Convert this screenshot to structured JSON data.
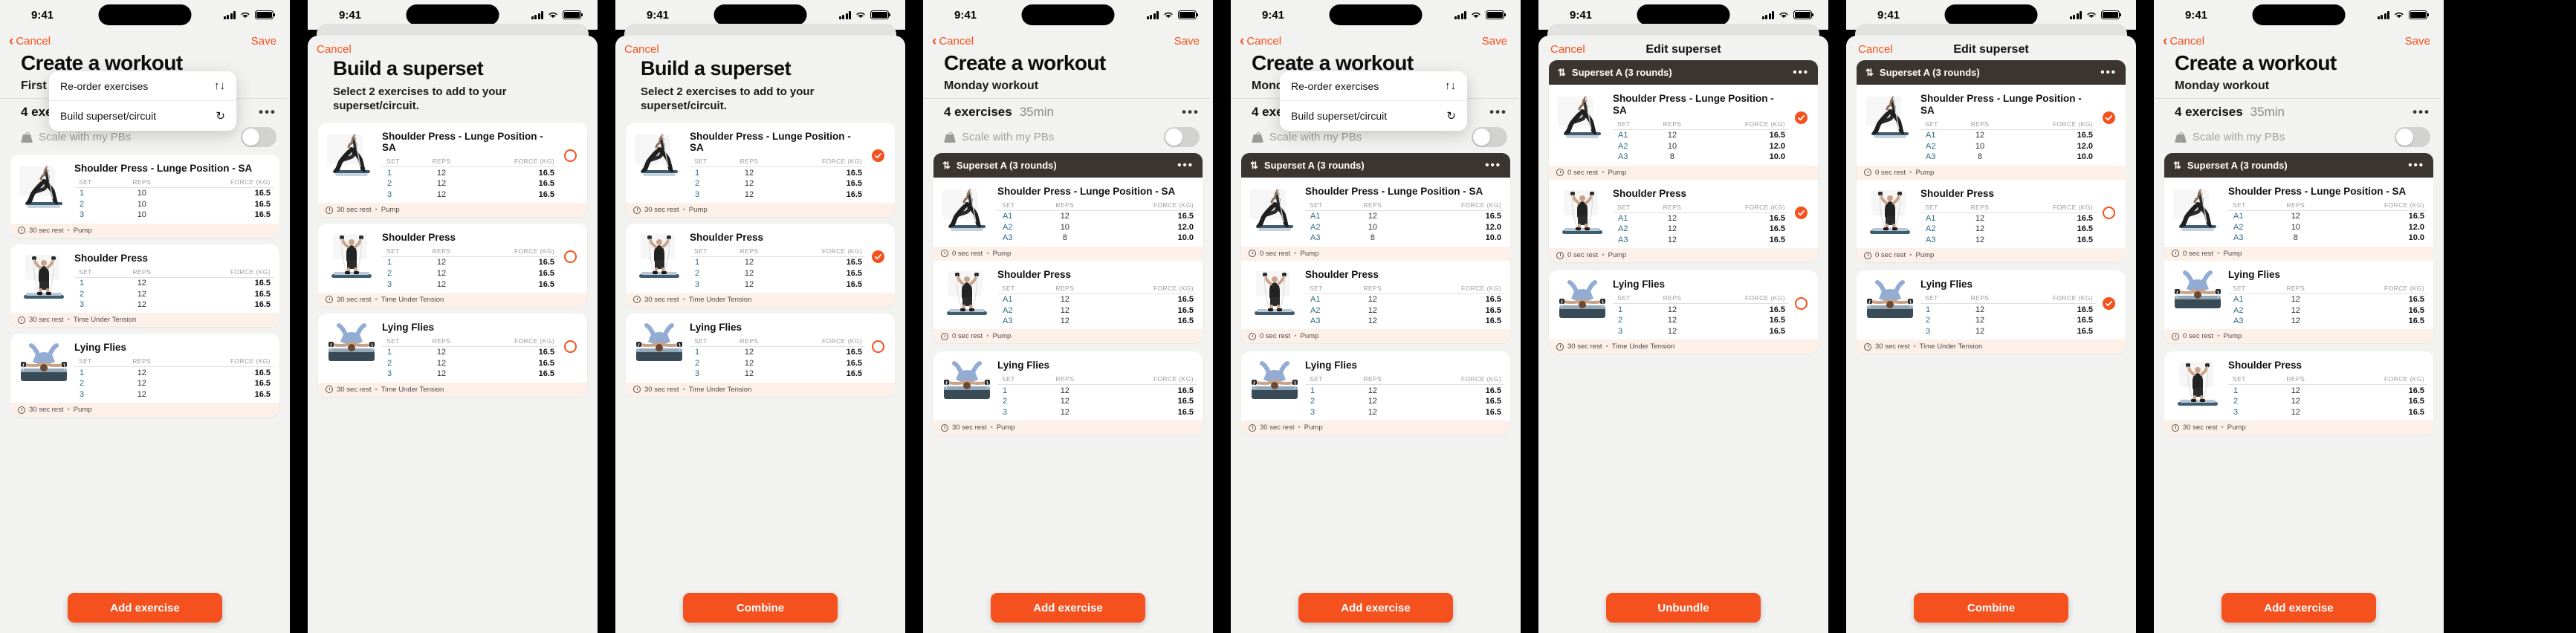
{
  "status_bar": {
    "time": "9:41"
  },
  "colors": {
    "accent": "#f4511e",
    "superset_header": "#3a3530",
    "card_foot": "#fdf0e9"
  },
  "common": {
    "cancel": "Cancel",
    "save": "Save",
    "dots": "•••",
    "swap_icon": "⇅",
    "reorder_icon": "↑↓",
    "loop_icon": "↻"
  },
  "menu": {
    "items": [
      {
        "label": "Re-order exercises",
        "icon": "arrows-up-down-icon",
        "glyph": "↑↓"
      },
      {
        "label": "Build superset/circuit",
        "icon": "loop-refresh-icon",
        "glyph": "↻"
      }
    ]
  },
  "screens": [
    {
      "id": "create-workout-menu-open",
      "type": "create",
      "title": "Create a workout",
      "subtitle": "First workout",
      "exercise_count": "4 exercises",
      "duration": "",
      "scale_label": "Scale with my PBs",
      "menu_open": true,
      "cta": "Add exercise",
      "cards": [
        {
          "name": "Shoulder Press - Lunge Position - SA",
          "thumb": "woman-lunge-press",
          "headers": [
            "SET",
            "REPS",
            "FORCE (KG)"
          ],
          "rows": [
            [
              "1",
              "10",
              "16.5"
            ],
            [
              "2",
              "10",
              "16.5"
            ],
            [
              "3",
              "10",
              "16.5"
            ]
          ],
          "rest": "30 sec rest",
          "mode": "Pump",
          "select": "none"
        },
        {
          "name": "Shoulder Press",
          "thumb": "man-shoulder-press",
          "headers": [
            "SET",
            "REPS",
            "FORCE (KG)"
          ],
          "rows": [
            [
              "1",
              "12",
              "16.5"
            ],
            [
              "2",
              "12",
              "16.5"
            ],
            [
              "3",
              "12",
              "16.5"
            ]
          ],
          "rest": "30 sec rest",
          "mode": "Time Under Tension",
          "select": "none"
        },
        {
          "name": "Lying Flies",
          "thumb": "lying-flies",
          "headers": [
            "SET",
            "REPS",
            "FORCE (KG)"
          ],
          "rows": [
            [
              "1",
              "12",
              "16.5"
            ],
            [
              "2",
              "12",
              "16.5"
            ],
            [
              "3",
              "12",
              "16.5"
            ]
          ],
          "rest": "30 sec rest",
          "mode": "Pump",
          "select": "none"
        }
      ]
    },
    {
      "id": "build-superset-unselected",
      "type": "sheet-build",
      "title": "Build a superset",
      "subtitle": "Select 2 exercises to add to your superset/circuit.",
      "cta": "",
      "cards": [
        {
          "name": "Shoulder Press - Lunge Position - SA",
          "thumb": "woman-lunge-press",
          "headers": [
            "SET",
            "REPS",
            "FORCE (KG)"
          ],
          "rows": [
            [
              "1",
              "12",
              "16.5"
            ],
            [
              "2",
              "12",
              "16.5"
            ],
            [
              "3",
              "12",
              "16.5"
            ]
          ],
          "rest": "30 sec rest",
          "mode": "Pump",
          "select": "empty"
        },
        {
          "name": "Shoulder Press",
          "thumb": "man-shoulder-press",
          "headers": [
            "SET",
            "REPS",
            "FORCE (KG)"
          ],
          "rows": [
            [
              "1",
              "12",
              "16.5"
            ],
            [
              "2",
              "12",
              "16.5"
            ],
            [
              "3",
              "12",
              "16.5"
            ]
          ],
          "rest": "30 sec rest",
          "mode": "Time Under Tension",
          "select": "empty"
        },
        {
          "name": "Lying Flies",
          "thumb": "lying-flies",
          "headers": [
            "SET",
            "REPS",
            "FORCE (KG)"
          ],
          "rows": [
            [
              "1",
              "12",
              "16.5"
            ],
            [
              "2",
              "12",
              "16.5"
            ],
            [
              "3",
              "12",
              "16.5"
            ]
          ],
          "rest": "30 sec rest",
          "mode": "Time Under Tension",
          "select": "empty"
        }
      ]
    },
    {
      "id": "build-superset-selected",
      "type": "sheet-build",
      "title": "Build a superset",
      "subtitle": "Select 2 exercises to add to your superset/circuit.",
      "cta": "Combine",
      "cards": [
        {
          "name": "Shoulder Press - Lunge Position - SA",
          "thumb": "woman-lunge-press",
          "headers": [
            "SET",
            "REPS",
            "FORCE (KG)"
          ],
          "rows": [
            [
              "1",
              "12",
              "16.5"
            ],
            [
              "2",
              "12",
              "16.5"
            ],
            [
              "3",
              "12",
              "16.5"
            ]
          ],
          "rest": "30 sec rest",
          "mode": "Pump",
          "select": "checked"
        },
        {
          "name": "Shoulder Press",
          "thumb": "man-shoulder-press",
          "headers": [
            "SET",
            "REPS",
            "FORCE (KG)"
          ],
          "rows": [
            [
              "1",
              "12",
              "16.5"
            ],
            [
              "2",
              "12",
              "16.5"
            ],
            [
              "3",
              "12",
              "16.5"
            ]
          ],
          "rest": "30 sec rest",
          "mode": "Time Under Tension",
          "select": "checked"
        },
        {
          "name": "Lying Flies",
          "thumb": "lying-flies",
          "headers": [
            "SET",
            "REPS",
            "FORCE (KG)"
          ],
          "rows": [
            [
              "1",
              "12",
              "16.5"
            ],
            [
              "2",
              "12",
              "16.5"
            ],
            [
              "3",
              "12",
              "16.5"
            ]
          ],
          "rest": "30 sec rest",
          "mode": "Time Under Tension",
          "select": "empty"
        }
      ]
    },
    {
      "id": "create-workout-superset",
      "type": "create",
      "title": "Create a workout",
      "subtitle": "Monday workout",
      "exercise_count": "4 exercises",
      "duration": "35min",
      "scale_label": "Scale with my PBs",
      "menu_open": false,
      "cta": "Add exercise",
      "superset": {
        "label": "Superset A (3 rounds)",
        "cards": [
          {
            "name": "Shoulder Press - Lunge Position - SA",
            "thumb": "woman-lunge-press",
            "headers": [
              "SET",
              "REPS",
              "FORCE (KG)"
            ],
            "rows": [
              [
                "A1",
                "12",
                "16.5"
              ],
              [
                "A2",
                "10",
                "12.0"
              ],
              [
                "A3",
                "8",
                "10.0"
              ]
            ],
            "rest": "0 sec rest",
            "mode": "Pump",
            "select": "none"
          },
          {
            "name": "Shoulder Press",
            "thumb": "man-shoulder-press",
            "headers": [
              "SET",
              "REPS",
              "FORCE (KG)"
            ],
            "rows": [
              [
                "A1",
                "12",
                "16.5"
              ],
              [
                "A2",
                "12",
                "16.5"
              ],
              [
                "A3",
                "12",
                "16.5"
              ]
            ],
            "rest": "0 sec rest",
            "mode": "Pump",
            "select": "none"
          }
        ]
      },
      "cards": [
        {
          "name": "Lying Flies",
          "thumb": "lying-flies",
          "headers": [
            "SET",
            "REPS",
            "FORCE (KG)"
          ],
          "rows": [
            [
              "1",
              "12",
              "16.5"
            ],
            [
              "2",
              "12",
              "16.5"
            ],
            [
              "3",
              "12",
              "16.5"
            ]
          ],
          "rest": "30 sec rest",
          "mode": "Pump",
          "select": "none"
        }
      ]
    },
    {
      "id": "create-workout-superset-menu-open",
      "type": "create",
      "title": "Create a workout",
      "subtitle": "Monday workout",
      "exercise_count": "4 exercises",
      "duration": "35min",
      "scale_label": "Scale with my PBs",
      "menu_open": true,
      "cta": "Add exercise",
      "superset": {
        "label": "Superset A (3 rounds)",
        "cards": [
          {
            "name": "Shoulder Press - Lunge Position - SA",
            "thumb": "woman-lunge-press",
            "headers": [
              "SET",
              "REPS",
              "FORCE (KG)"
            ],
            "rows": [
              [
                "A1",
                "12",
                "16.5"
              ],
              [
                "A2",
                "10",
                "12.0"
              ],
              [
                "A3",
                "8",
                "10.0"
              ]
            ],
            "rest": "0 sec rest",
            "mode": "Pump",
            "select": "none"
          },
          {
            "name": "Shoulder Press",
            "thumb": "man-shoulder-press",
            "headers": [
              "SET",
              "REPS",
              "FORCE (KG)"
            ],
            "rows": [
              [
                "A1",
                "12",
                "16.5"
              ],
              [
                "A2",
                "12",
                "16.5"
              ],
              [
                "A3",
                "12",
                "16.5"
              ]
            ],
            "rest": "0 sec rest",
            "mode": "Pump",
            "select": "none"
          }
        ]
      },
      "cards": [
        {
          "name": "Lying Flies",
          "thumb": "lying-flies",
          "headers": [
            "SET",
            "REPS",
            "FORCE (KG)"
          ],
          "rows": [
            [
              "1",
              "12",
              "16.5"
            ],
            [
              "2",
              "12",
              "16.5"
            ],
            [
              "3",
              "12",
              "16.5"
            ]
          ],
          "rest": "30 sec rest",
          "mode": "Pump",
          "select": "none"
        }
      ]
    },
    {
      "id": "edit-superset-unbundle",
      "type": "sheet-edit",
      "title": "Edit superset",
      "superset_label": "Superset A (3 rounds)",
      "cta": "Unbundle",
      "superset_cards": [
        {
          "name": "Shoulder Press - Lunge Position - SA",
          "thumb": "woman-lunge-press",
          "headers": [
            "SET",
            "REPS",
            "FORCE (KG)"
          ],
          "rows": [
            [
              "A1",
              "12",
              "16.5"
            ],
            [
              "A2",
              "10",
              "12.0"
            ],
            [
              "A3",
              "8",
              "10.0"
            ]
          ],
          "rest": "0 sec rest",
          "mode": "Pump",
          "select": "checked"
        },
        {
          "name": "Shoulder Press",
          "thumb": "man-shoulder-press",
          "headers": [
            "SET",
            "REPS",
            "FORCE (KG)"
          ],
          "rows": [
            [
              "A1",
              "12",
              "16.5"
            ],
            [
              "A2",
              "12",
              "16.5"
            ],
            [
              "A3",
              "12",
              "16.5"
            ]
          ],
          "rest": "0 sec rest",
          "mode": "Pump",
          "select": "checked"
        }
      ],
      "cards": [
        {
          "name": "Lying Flies",
          "thumb": "lying-flies",
          "headers": [
            "SET",
            "REPS",
            "FORCE (KG)"
          ],
          "rows": [
            [
              "1",
              "12",
              "16.5"
            ],
            [
              "2",
              "12",
              "16.5"
            ],
            [
              "3",
              "12",
              "16.5"
            ]
          ],
          "rest": "30 sec rest",
          "mode": "Time Under Tension",
          "select": "empty"
        }
      ]
    },
    {
      "id": "edit-superset-combine",
      "type": "sheet-edit",
      "title": "Edit superset",
      "superset_label": "Superset A (3 rounds)",
      "cta": "Combine",
      "superset_cards": [
        {
          "name": "Shoulder Press - Lunge Position - SA",
          "thumb": "woman-lunge-press",
          "headers": [
            "SET",
            "REPS",
            "FORCE (KG)"
          ],
          "rows": [
            [
              "A1",
              "12",
              "16.5"
            ],
            [
              "A2",
              "10",
              "12.0"
            ],
            [
              "A3",
              "8",
              "10.0"
            ]
          ],
          "rest": "0 sec rest",
          "mode": "Pump",
          "select": "checked"
        },
        {
          "name": "Shoulder Press",
          "thumb": "man-shoulder-press",
          "headers": [
            "SET",
            "REPS",
            "FORCE (KG)"
          ],
          "rows": [
            [
              "A1",
              "12",
              "16.5"
            ],
            [
              "A2",
              "12",
              "16.5"
            ],
            [
              "A3",
              "12",
              "16.5"
            ]
          ],
          "rest": "0 sec rest",
          "mode": "Pump",
          "select": "empty"
        }
      ],
      "cards": [
        {
          "name": "Lying Flies",
          "thumb": "lying-flies",
          "headers": [
            "SET",
            "REPS",
            "FORCE (KG)"
          ],
          "rows": [
            [
              "1",
              "12",
              "16.5"
            ],
            [
              "2",
              "12",
              "16.5"
            ],
            [
              "3",
              "12",
              "16.5"
            ]
          ],
          "rest": "30 sec rest",
          "mode": "Time Under Tension",
          "select": "checked"
        }
      ]
    },
    {
      "id": "create-workout-final",
      "type": "create",
      "title": "Create a workout",
      "subtitle": "Monday workout",
      "exercise_count": "4 exercises",
      "duration": "35min",
      "scale_label": "Scale with my PBs",
      "menu_open": false,
      "cta": "Add exercise",
      "superset": {
        "label": "Superset A (3 rounds)",
        "cards": [
          {
            "name": "Shoulder Press - Lunge Position - SA",
            "thumb": "woman-lunge-press",
            "headers": [
              "SET",
              "REPS",
              "FORCE (KG)"
            ],
            "rows": [
              [
                "A1",
                "12",
                "16.5"
              ],
              [
                "A2",
                "10",
                "12.0"
              ],
              [
                "A3",
                "8",
                "10.0"
              ]
            ],
            "rest": "0 sec rest",
            "mode": "Pump",
            "select": "none"
          },
          {
            "name": "Lying Flies",
            "thumb": "lying-flies",
            "headers": [
              "SET",
              "REPS",
              "FORCE (KG)"
            ],
            "rows": [
              [
                "A1",
                "12",
                "16.5"
              ],
              [
                "A2",
                "12",
                "16.5"
              ],
              [
                "A3",
                "12",
                "16.5"
              ]
            ],
            "rest": "0 sec rest",
            "mode": "Pump",
            "select": "none"
          }
        ]
      },
      "cards": [
        {
          "name": "Shoulder Press",
          "thumb": "man-shoulder-press",
          "headers": [
            "SET",
            "REPS",
            "FORCE (KG)"
          ],
          "rows": [
            [
              "1",
              "12",
              "16.5"
            ],
            [
              "2",
              "12",
              "16.5"
            ],
            [
              "3",
              "12",
              "16.5"
            ]
          ],
          "rest": "30 sec rest",
          "mode": "Pump",
          "select": "none"
        }
      ]
    }
  ]
}
